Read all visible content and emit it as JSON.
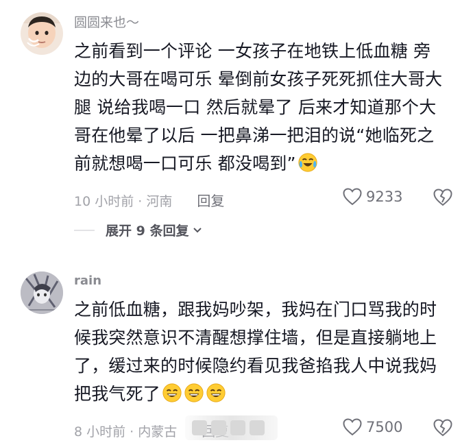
{
  "comments": [
    {
      "username": "圆圆来也～",
      "lines": [
        "之前看到一个评论 一女孩子在地铁上低血糖 旁",
        "边的大哥在喝可乐 晕倒前女孩子死死抓住大哥大",
        "腿 说给我喝一口 然后就晕了 后来才知道那个大",
        "哥在他晕了以后 一把鼻涕一把泪的说“她临死之",
        "前就想喝一口可乐 都没喝到”"
      ],
      "emoji": [
        "crying-laughing-emoji"
      ],
      "time_location": "10 小时前 · 河南",
      "reply_label": "回复",
      "likes": "9233",
      "expand_label": "展开 9 条回复"
    },
    {
      "username": "rain",
      "lines": [
        "之前低血糖，跟我妈吵架，我妈在门口骂我的时",
        "候我突然意识不清醒想撑住墙，但是直接躺地上",
        "了，缓过来的时候隐约看见我爸掐我人中说我妈",
        "把我气死了"
      ],
      "emoji": [
        "grinning-emoji",
        "grinning-emoji",
        "grinning-emoji"
      ],
      "time_location": "8 小时前 · 内蒙古",
      "reply_label": "回复",
      "likes": "7500"
    }
  ],
  "colors": {
    "text": "#161823",
    "muted": "#a1a2a8",
    "username": "#8a8b91",
    "emoji_yellow": "#ffcc33"
  }
}
